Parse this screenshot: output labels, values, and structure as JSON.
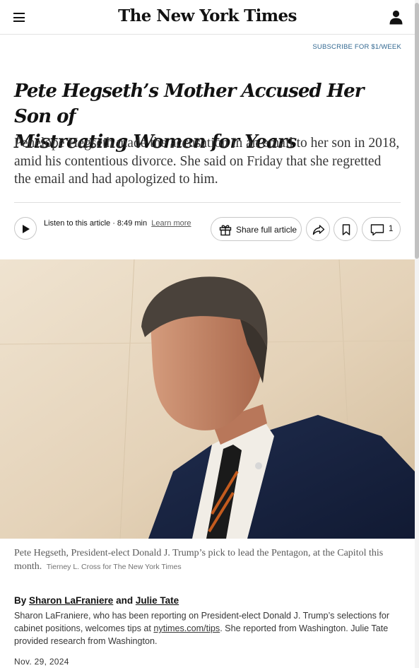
{
  "masthead": {
    "logo_text": "The New York Times",
    "menu_icon": "hamburger-menu-icon",
    "account_icon": "user-account-icon"
  },
  "subscribe": {
    "label": "SUBSCRIBE FOR $1/WEEK"
  },
  "article": {
    "headline_line1": "Pete Hegseth’s Mother Accused Her Son of",
    "headline_line2": "Mistreating Women for Years",
    "summary": "Penelope Hegseth made the accusation in an email to her son in 2018, amid his contentious divorce. She said on Friday that she regretted the email and had apologized to him."
  },
  "toolbar": {
    "listen_label": "Listen to this article · 8:49 min",
    "learn_more": "Learn more",
    "share_label": "Share full article",
    "comment_count": "1",
    "icons": [
      "play-icon",
      "gift-icon",
      "share-arrow-icon",
      "bookmark-icon",
      "comment-bubble-icon"
    ]
  },
  "photo": {
    "caption": "Pete Hegseth, President-elect Donald J. Trump’s pick to lead the Pentagon, at the Capitol this month.",
    "credit": "Tierney L. Cross for The New York Times"
  },
  "byline": {
    "prefix": "By",
    "author1": "Sharon LaFraniere",
    "conjunction": "and",
    "author2": "Julie Tate",
    "bio_part1": "Sharon LaFraniere, who has been reporting on President-elect Donald J. Trump’s selections for cabinet positions, welcomes tips at",
    "bio_link": "nytimes.com/tips",
    "bio_part2": ". She reported from Washington. Julie Tate provided research from Washington."
  },
  "date": "Nov. 29, 2024",
  "colors": {
    "link_blue": "#326891",
    "text_dark": "#121212",
    "border": "#c7c7c7"
  }
}
